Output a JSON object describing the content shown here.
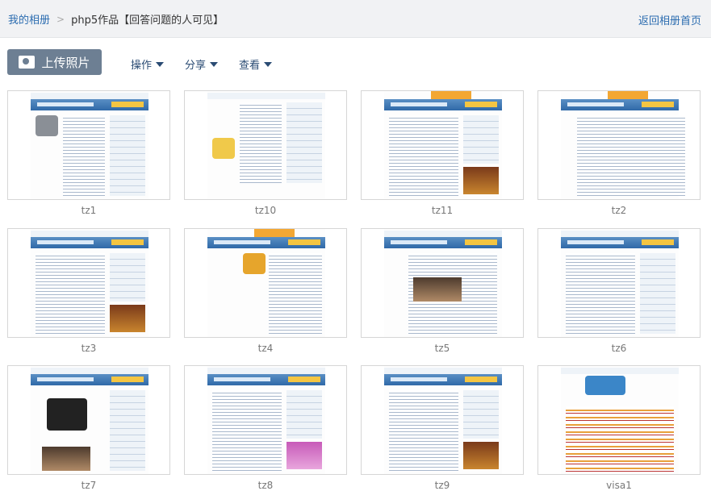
{
  "breadcrumb": {
    "home": "我的相册",
    "separator": ">",
    "current": "php5作品【回答问题的人可见】"
  },
  "header": {
    "back_link": "返回相册首页"
  },
  "toolbar": {
    "upload_label": "上传照片",
    "menus": [
      {
        "label": "操作"
      },
      {
        "label": "分享"
      },
      {
        "label": "查看"
      }
    ]
  },
  "photos": [
    {
      "name": "tz1"
    },
    {
      "name": "tz10"
    },
    {
      "name": "tz11"
    },
    {
      "name": "tz2"
    },
    {
      "name": "tz3"
    },
    {
      "name": "tz4"
    },
    {
      "name": "tz5"
    },
    {
      "name": "tz6"
    },
    {
      "name": "tz7"
    },
    {
      "name": "tz8"
    },
    {
      "name": "tz9"
    },
    {
      "name": "visa1"
    }
  ]
}
